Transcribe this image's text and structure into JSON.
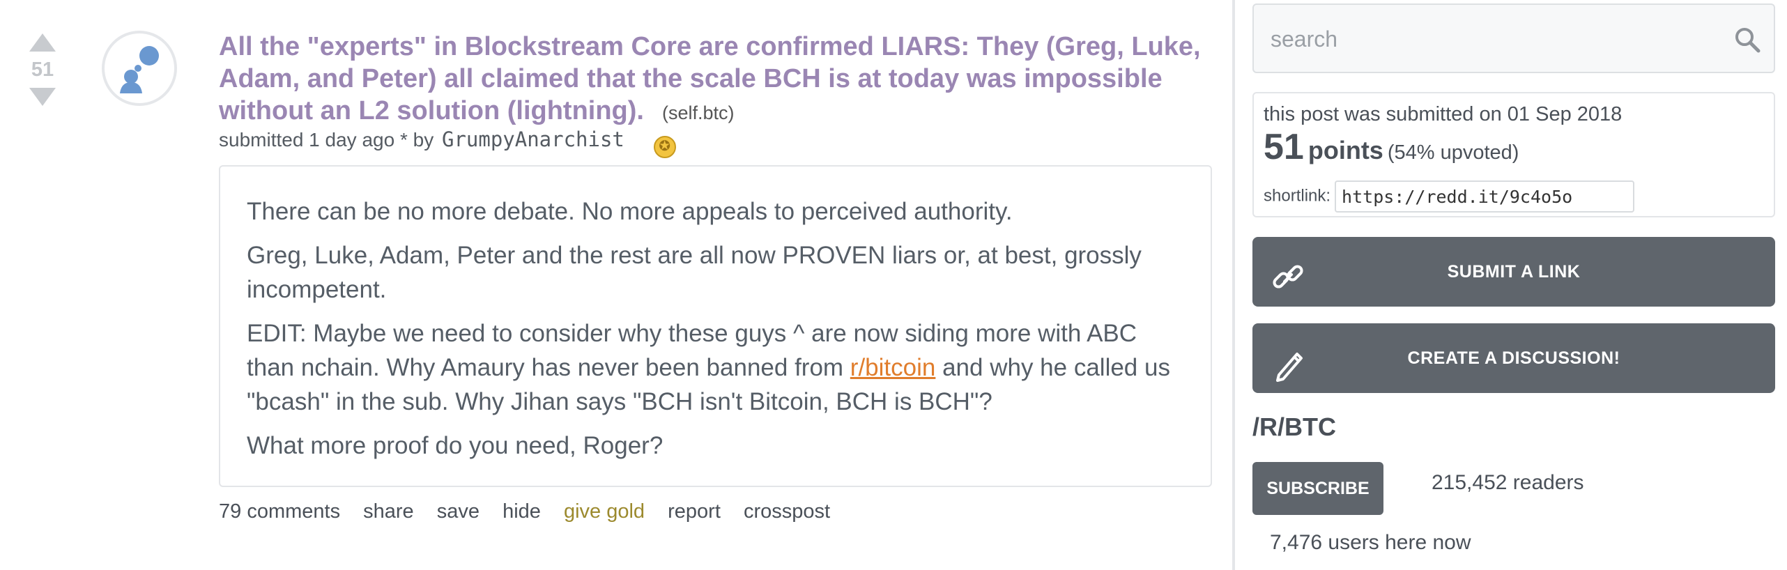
{
  "post": {
    "score": "51",
    "title": "All the \"experts\" in Blockstream Core are confirmed LIARS: They (Greg, Luke, Adam, and Peter) all claimed that the scale BCH is at today was impossible without an L2 solution (lightning).",
    "domain": "(self.btc)",
    "tagline_prefix": "submitted 1 day ago * by",
    "author": "GrumpyAnarchist",
    "body": {
      "p1": "There can be no more debate. No more appeals to perceived authority.",
      "p2": "Greg, Luke, Adam, Peter and the rest are all now PROVEN liars or, at best, grossly incompetent.",
      "p3_before": "EDIT: Maybe we need to consider why these guys ^ are now siding more with ABC than nchain. Why Amaury has never been banned from ",
      "p3_link": "r/bitcoin",
      "p3_after": " and why he called us \"bcash\" in the sub. Why Jihan says \"BCH isn't Bitcoin, BCH is BCH\"?",
      "p4": "What more proof do you need, Roger?"
    },
    "buttons": {
      "comments": "79 comments",
      "share": "share",
      "save": "save",
      "hide": "hide",
      "give_gold": "give gold",
      "report": "report",
      "crosspost": "crosspost"
    }
  },
  "sidebar": {
    "search_placeholder": "search",
    "submitted_on": "this post was submitted on 01 Sep 2018",
    "points": "51",
    "points_word": "points",
    "upvoted": "(54% upvoted)",
    "shortlink_label": "shortlink:",
    "shortlink": "https://redd.it/9c4o5o",
    "submit_link": "SUBMIT A LINK",
    "create_discussion": "CREATE A DISCUSSION!",
    "subreddit": "/R/BTC",
    "subscribe": "SUBSCRIBE",
    "readers": "215,452 readers",
    "online": "7,476 users here now"
  },
  "colors": {
    "title": "#9a86b3",
    "link": "#e07d2c",
    "gold": "#9c8a2e",
    "sidebar_button": "#5f656c"
  },
  "icons": [
    "upvote-arrow-icon",
    "downvote-arrow-icon",
    "self-post-thumbnail-icon",
    "award-icon",
    "search-icon",
    "link-icon",
    "pencil-icon"
  ]
}
